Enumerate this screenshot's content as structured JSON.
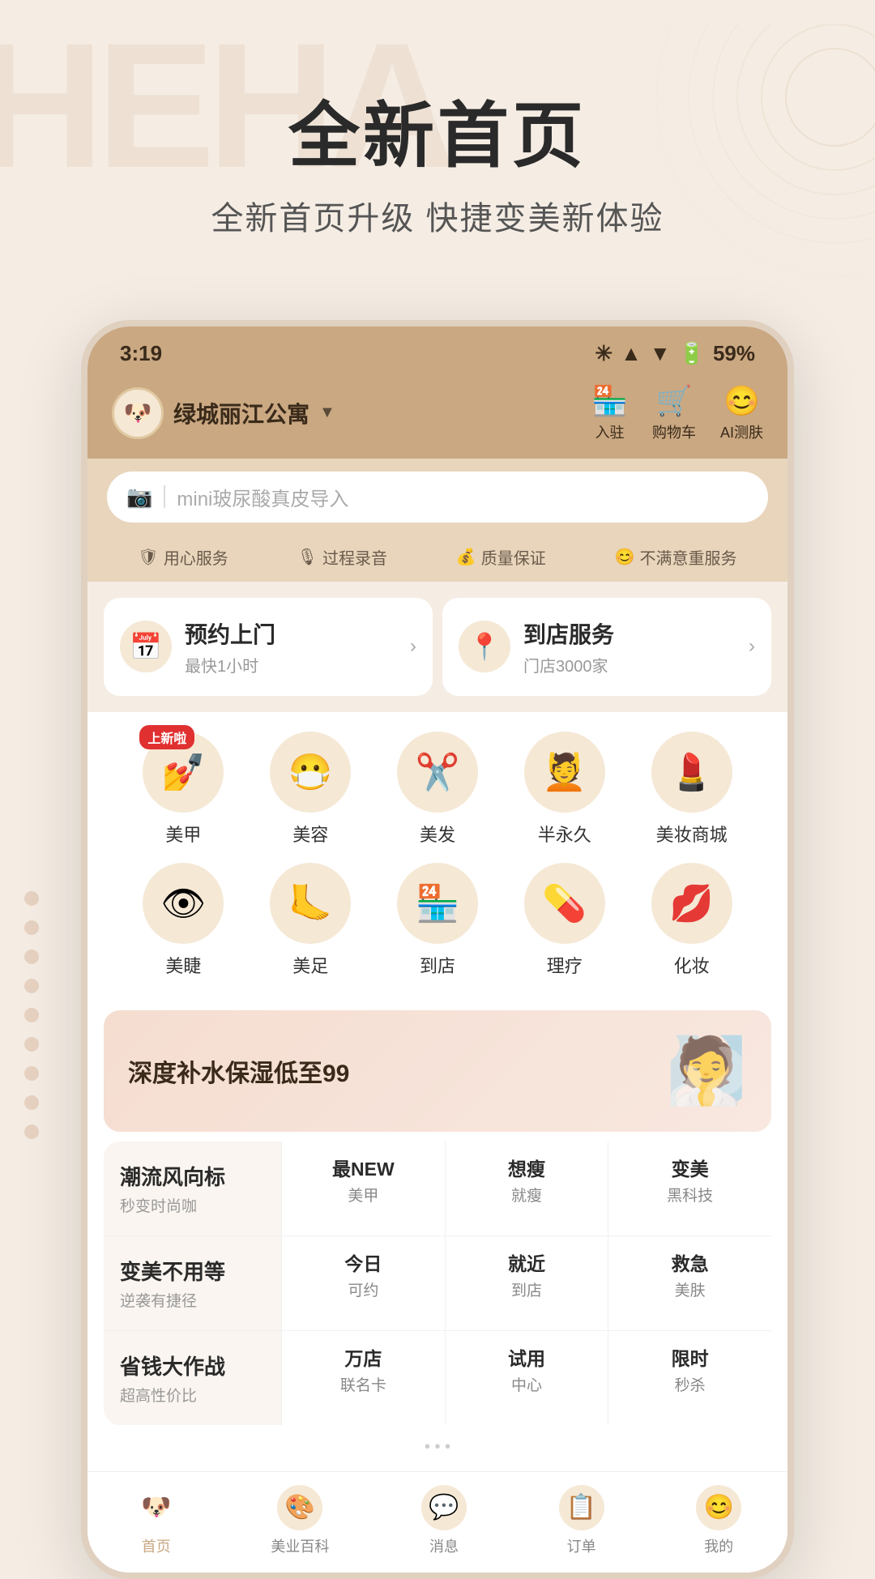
{
  "page": {
    "bg_text": "HEHA",
    "main_title": "全新首页",
    "sub_title": "全新首页升级  快捷变美新体验"
  },
  "status_bar": {
    "time": "3:19",
    "battery": "59%",
    "icons": "✳ 📶 🔋"
  },
  "app_header": {
    "location": "绿城丽江公寓",
    "icons": [
      {
        "symbol": "🏪",
        "label": "入驻"
      },
      {
        "symbol": "🛒",
        "label": "购物车"
      },
      {
        "symbol": "😊",
        "label": "AI测肤"
      }
    ]
  },
  "search": {
    "placeholder": "mini玻尿酸真皮导入"
  },
  "tags": [
    {
      "icon": "🛡",
      "text": "用心服务"
    },
    {
      "icon": "🎙",
      "text": "过程录音"
    },
    {
      "icon": "💰",
      "text": "质量保证"
    },
    {
      "icon": "😊",
      "text": "不满意重服务"
    }
  ],
  "services": [
    {
      "icon": "📅",
      "name": "预约上门",
      "sub": "最快1小时",
      "arrow": "›"
    },
    {
      "icon": "📍",
      "name": "到店服务",
      "sub": "门店3000家",
      "arrow": "›"
    }
  ],
  "categories": [
    {
      "icon": "💅",
      "label": "美甲",
      "new": true
    },
    {
      "icon": "😷",
      "label": "美容",
      "new": false
    },
    {
      "icon": "✂️",
      "label": "美发",
      "new": false
    },
    {
      "icon": "💆",
      "label": "半永久",
      "new": false
    },
    {
      "icon": "💄",
      "label": "美妆商城",
      "new": false
    },
    {
      "icon": "👁",
      "label": "美睫",
      "new": false
    },
    {
      "icon": "🦶",
      "label": "美足",
      "new": false
    },
    {
      "icon": "🏪",
      "label": "到店",
      "new": false
    },
    {
      "icon": "💊",
      "label": "理疗",
      "new": false
    },
    {
      "icon": "💋",
      "label": "化妆",
      "new": false
    }
  ],
  "new_badge_text": "上新啦",
  "banner": {
    "text": "深度补水保湿低至99"
  },
  "quick_menu": [
    {
      "category": "潮流风向标",
      "sub": "秒变时尚咖",
      "items": [
        {
          "title": "最NEW",
          "sub": "美甲"
        },
        {
          "title": "想瘦",
          "sub": "就瘦"
        },
        {
          "title": "变美",
          "sub": "黑科技"
        }
      ]
    },
    {
      "category": "变美不用等",
      "sub": "逆袭有捷径",
      "items": [
        {
          "title": "今日",
          "sub": "可约"
        },
        {
          "title": "就近",
          "sub": "到店"
        },
        {
          "title": "救急",
          "sub": "美肤"
        }
      ]
    },
    {
      "category": "省钱大作战",
      "sub": "超高性价比",
      "items": [
        {
          "title": "万店",
          "sub": "联名卡"
        },
        {
          "title": "试用",
          "sub": "中心"
        },
        {
          "title": "限时",
          "sub": "秒杀"
        }
      ]
    }
  ],
  "bottom_nav": [
    {
      "icon": "🐶",
      "label": "首页",
      "active": true
    },
    {
      "icon": "🎨",
      "label": "美业百科",
      "active": false
    },
    {
      "icon": "💬",
      "label": "消息",
      "active": false
    },
    {
      "icon": "📋",
      "label": "订单",
      "active": false
    },
    {
      "icon": "😊",
      "label": "我的",
      "active": false
    }
  ]
}
